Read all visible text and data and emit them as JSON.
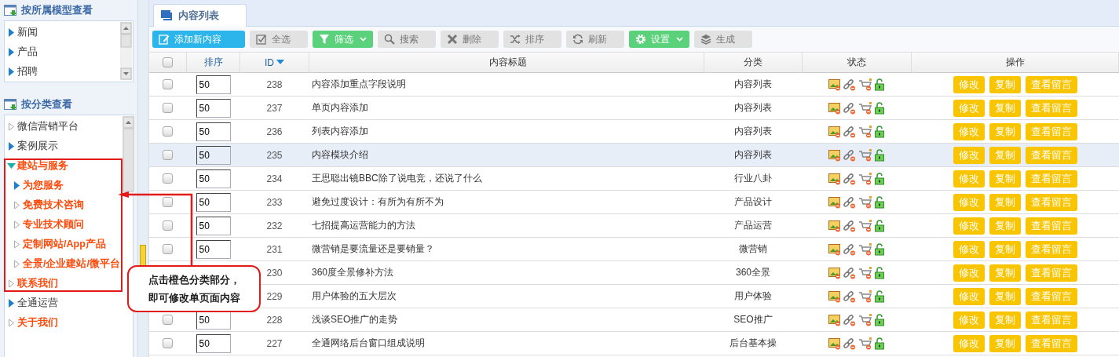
{
  "sidebar": {
    "panels": [
      {
        "title": "按所属模型查看",
        "items": [
          {
            "label": "新闻",
            "kind": "filled",
            "orange": false,
            "expanded": false
          },
          {
            "label": "产品",
            "kind": "filled",
            "orange": false,
            "expanded": false
          },
          {
            "label": "招聘",
            "kind": "filled",
            "orange": false,
            "expanded": false
          }
        ]
      },
      {
        "title": "按分类查看",
        "items": [
          {
            "label": "微信营销平台",
            "kind": "hollow",
            "orange": false,
            "expanded": false
          },
          {
            "label": "案例展示",
            "kind": "filled",
            "orange": false,
            "expanded": false
          },
          {
            "label": "建站与服务",
            "kind": "filled",
            "orange": true,
            "expanded": true,
            "children": [
              {
                "label": "为您服务",
                "kind": "filled",
                "orange": true,
                "expanded": false
              },
              {
                "label": "免费技术咨询",
                "kind": "hollow",
                "orange": true,
                "expanded": false
              },
              {
                "label": "专业技术顾问",
                "kind": "hollow",
                "orange": true,
                "expanded": false
              },
              {
                "label": "定制网站/App产品",
                "kind": "hollow",
                "orange": true,
                "expanded": false
              },
              {
                "label": "全景/企业建站/微平台",
                "kind": "hollow",
                "orange": true,
                "expanded": false
              }
            ]
          },
          {
            "label": "联系我们",
            "kind": "hollow",
            "orange": true,
            "expanded": false
          },
          {
            "label": "全通运营",
            "kind": "filled",
            "orange": false,
            "expanded": false
          },
          {
            "label": "关于我们",
            "kind": "hollow",
            "orange": true,
            "expanded": false
          }
        ]
      }
    ]
  },
  "tabs": [
    {
      "label": "内容列表",
      "selected": true
    }
  ],
  "toolbar": [
    {
      "label": "添加新内容",
      "kind": "primary"
    },
    {
      "label": "全选",
      "kind": "plain"
    },
    {
      "label": "筛选",
      "kind": "menu"
    },
    {
      "label": "搜索",
      "kind": "plain"
    },
    {
      "label": "删除",
      "kind": "plain"
    },
    {
      "label": "排序",
      "kind": "plain"
    },
    {
      "label": "刷新",
      "kind": "plain"
    },
    {
      "label": "设置",
      "kind": "menu"
    },
    {
      "label": "生成",
      "kind": "plain"
    }
  ],
  "table": {
    "select_all": {
      "checked": false
    },
    "columns": [
      {
        "label": "排序",
        "sorted": false
      },
      {
        "label": "ID",
        "sorted": true
      },
      {
        "label": "内容标题",
        "sorted": false
      },
      {
        "label": "分类",
        "sorted": false
      },
      {
        "label": "状态",
        "sorted": false
      },
      {
        "label": "操作",
        "sorted": false
      }
    ],
    "rows": [
      {
        "checked": false,
        "selected": false,
        "order": "50",
        "id": "238",
        "title": "内容添加重点字段说明",
        "category": "内容列表",
        "actions": [
          "修改",
          "复制",
          "查看留言"
        ]
      },
      {
        "checked": false,
        "selected": false,
        "order": "50",
        "id": "237",
        "title": "单页内容添加",
        "category": "内容列表",
        "actions": [
          "修改",
          "复制",
          "查看留言"
        ]
      },
      {
        "checked": false,
        "selected": false,
        "order": "50",
        "id": "236",
        "title": "列表内容添加",
        "category": "内容列表",
        "actions": [
          "修改",
          "复制",
          "查看留言"
        ]
      },
      {
        "checked": false,
        "selected": true,
        "order": "50",
        "id": "235",
        "title": "内容模块介绍",
        "category": "内容列表",
        "actions": [
          "修改",
          "复制",
          "查看留言"
        ]
      },
      {
        "checked": false,
        "selected": false,
        "order": "50",
        "id": "234",
        "title": "王思聪出镜BBC除了说电竞，还说了什么",
        "category": "行业八卦",
        "actions": [
          "修改",
          "复制",
          "查看留言"
        ]
      },
      {
        "checked": false,
        "selected": false,
        "order": "50",
        "id": "233",
        "title": "避免过度设计：有所为有所不为",
        "category": "产品设计",
        "actions": [
          "修改",
          "复制",
          "查看留言"
        ]
      },
      {
        "checked": false,
        "selected": false,
        "order": "50",
        "id": "232",
        "title": "七招提高运营能力的方法",
        "category": "产品运营",
        "actions": [
          "修改",
          "复制",
          "查看留言"
        ]
      },
      {
        "checked": false,
        "selected": false,
        "order": "50",
        "id": "231",
        "title": "微营销是要流量还是要销量？",
        "category": "微营销",
        "actions": [
          "修改",
          "复制",
          "查看留言"
        ]
      },
      {
        "selected": false,
        "id": "230",
        "title": "360度全景修补方法",
        "category": "360全景",
        "actions": [
          "修改",
          "复制",
          "查看留言"
        ]
      },
      {
        "selected": false,
        "id": "229",
        "title": "用户体验的五大层次",
        "category": "用户体验",
        "actions": [
          "修改",
          "复制",
          "查看留言"
        ]
      },
      {
        "checked": false,
        "selected": false,
        "order": "50",
        "id": "228",
        "title": "浅谈SEO推广的走势",
        "category": "SEO推广",
        "actions": [
          "修改",
          "复制",
          "查看留言"
        ]
      },
      {
        "checked": false,
        "selected": false,
        "order": "50",
        "id": "227",
        "title": "全通网络后台窗口组成说明",
        "category": "后台基本操",
        "actions": [
          "修改",
          "复制",
          "查看留言"
        ]
      }
    ]
  },
  "annotation": {
    "lines": [
      "点击橙色分类部分，",
      "即可修改单页面内容"
    ]
  }
}
